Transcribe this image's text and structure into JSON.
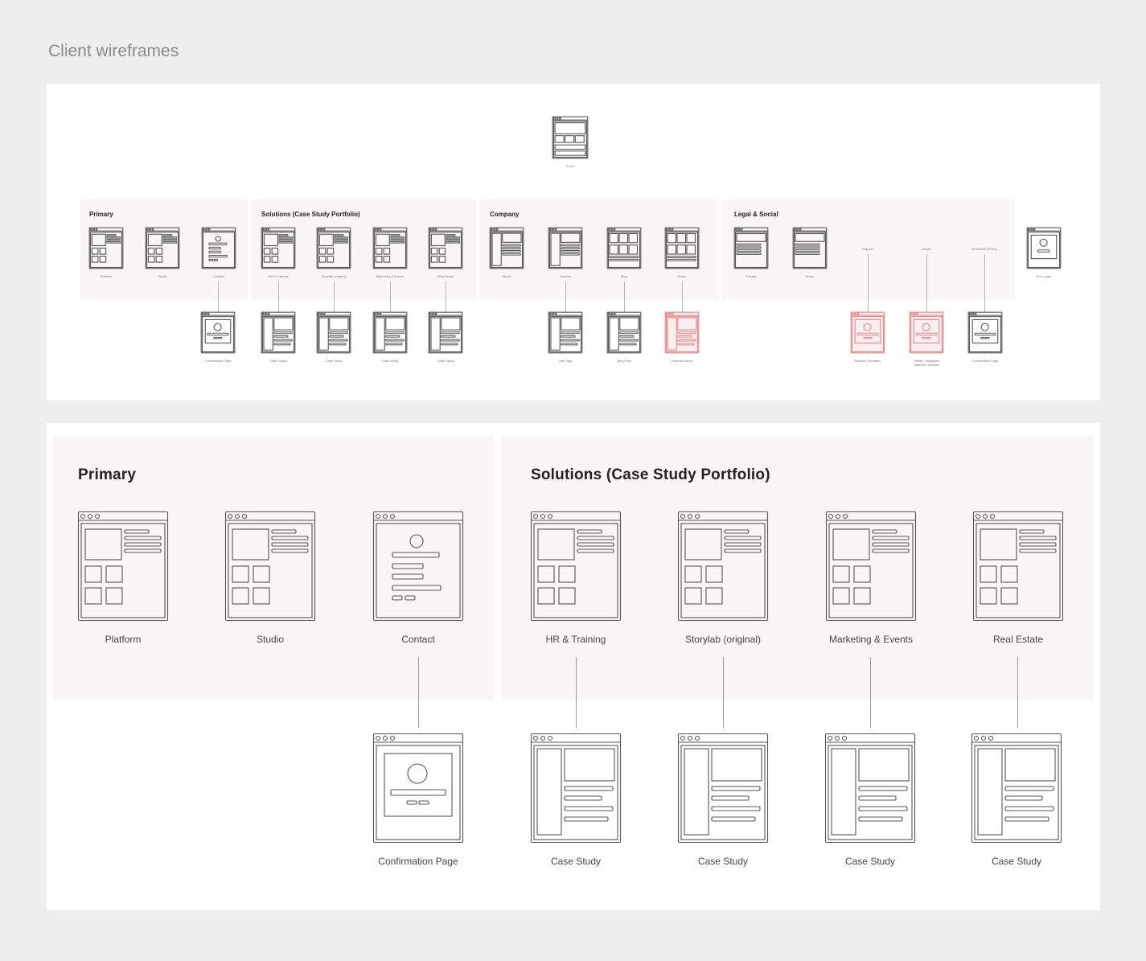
{
  "page": {
    "title": "Client wireframes"
  },
  "overview": {
    "home": {
      "label": "Home",
      "icon": "home-wireframe-icon"
    },
    "groups": [
      {
        "title": "Primary",
        "pages": [
          {
            "label": "Platform",
            "icon": "grid-page-wireframe-icon"
          },
          {
            "label": "Studio",
            "icon": "grid-page-wireframe-icon"
          },
          {
            "label": "Contact",
            "icon": "form-page-wireframe-icon"
          }
        ]
      },
      {
        "title": "Solutions (Case Study Portfolio)",
        "pages": [
          {
            "label": "HR & Training",
            "icon": "grid-page-wireframe-icon"
          },
          {
            "label": "Storylab (original)",
            "icon": "grid-page-wireframe-icon"
          },
          {
            "label": "Marketing & Events",
            "icon": "grid-page-wireframe-icon"
          },
          {
            "label": "Real Estate",
            "icon": "grid-page-wireframe-icon"
          }
        ]
      },
      {
        "title": "Company",
        "pages": [
          {
            "label": "About",
            "icon": "sidebar-page-wireframe-icon"
          },
          {
            "label": "Careers",
            "icon": "sidebar-page-wireframe-icon"
          },
          {
            "label": "Blog",
            "icon": "tiles-page-wireframe-icon"
          },
          {
            "label": "Press",
            "icon": "tiles-page-wireframe-icon"
          }
        ]
      },
      {
        "title": "Legal & Social",
        "pages": [
          {
            "label": "Privacy",
            "icon": "text-page-wireframe-icon"
          },
          {
            "label": "Terms",
            "icon": "text-page-wireframe-icon"
          }
        ],
        "link_labels": [
          "Support",
          "Social",
          "Newsletter (Form)"
        ]
      }
    ],
    "error_page": {
      "label": "Error page",
      "icon": "error-page-wireframe-icon"
    },
    "children": [
      {
        "label": "Confirmation Page",
        "icon": "confirmation-wireframe-icon",
        "external": false
      },
      {
        "label": "Case Study",
        "icon": "article-wireframe-icon",
        "external": false
      },
      {
        "label": "Case Study",
        "icon": "article-wireframe-icon",
        "external": false
      },
      {
        "label": "Case Study",
        "icon": "article-wireframe-icon",
        "external": false
      },
      {
        "label": "Case Study",
        "icon": "article-wireframe-icon",
        "external": false
      },
      {
        "label": "Job Page",
        "icon": "article-wireframe-icon",
        "external": false
      },
      {
        "label": "Blog Post",
        "icon": "article-wireframe-icon",
        "external": false
      },
      {
        "label": "External Article",
        "icon": "article-wireframe-icon",
        "external": true
      },
      {
        "label": "Support (Zendesk)",
        "icon": "confirmation-wireframe-icon",
        "external": true
      },
      {
        "label": "Twitter / Instagram",
        "label2": "LinkedIn / Medium",
        "icon": "confirmation-wireframe-icon",
        "external": true
      },
      {
        "label": "Confirmation Page",
        "icon": "confirmation-wireframe-icon",
        "external": false
      }
    ]
  },
  "detail": {
    "groups": [
      {
        "title": "Primary",
        "pages": [
          {
            "label": "Platform",
            "icon": "grid-page-wireframe-icon"
          },
          {
            "label": "Studio",
            "icon": "grid-page-wireframe-icon"
          },
          {
            "label": "Contact",
            "icon": "form-page-wireframe-icon"
          }
        ]
      },
      {
        "title": "Solutions (Case Study Portfolio)",
        "pages": [
          {
            "label": "HR & Training",
            "icon": "grid-page-wireframe-icon"
          },
          {
            "label": "Storylab (original)",
            "icon": "grid-page-wireframe-icon"
          },
          {
            "label": "Marketing & Events",
            "icon": "grid-page-wireframe-icon"
          },
          {
            "label": "Real Estate",
            "icon": "grid-page-wireframe-icon"
          }
        ]
      }
    ],
    "children": [
      {
        "label": "Confirmation Page",
        "icon": "confirmation-wireframe-icon"
      },
      {
        "label": "Case Study",
        "icon": "article-wireframe-icon"
      },
      {
        "label": "Case Study",
        "icon": "article-wireframe-icon"
      },
      {
        "label": "Case Study",
        "icon": "article-wireframe-icon"
      },
      {
        "label": "Case Study",
        "icon": "article-wireframe-icon"
      }
    ]
  },
  "colors": {
    "background": "#eeeeec",
    "card": "#ffffff",
    "group": "#f8f6f6",
    "wireframe_stroke": "#555555",
    "external_stroke": "#e08a8a",
    "external_fill": "#fbeeee"
  }
}
